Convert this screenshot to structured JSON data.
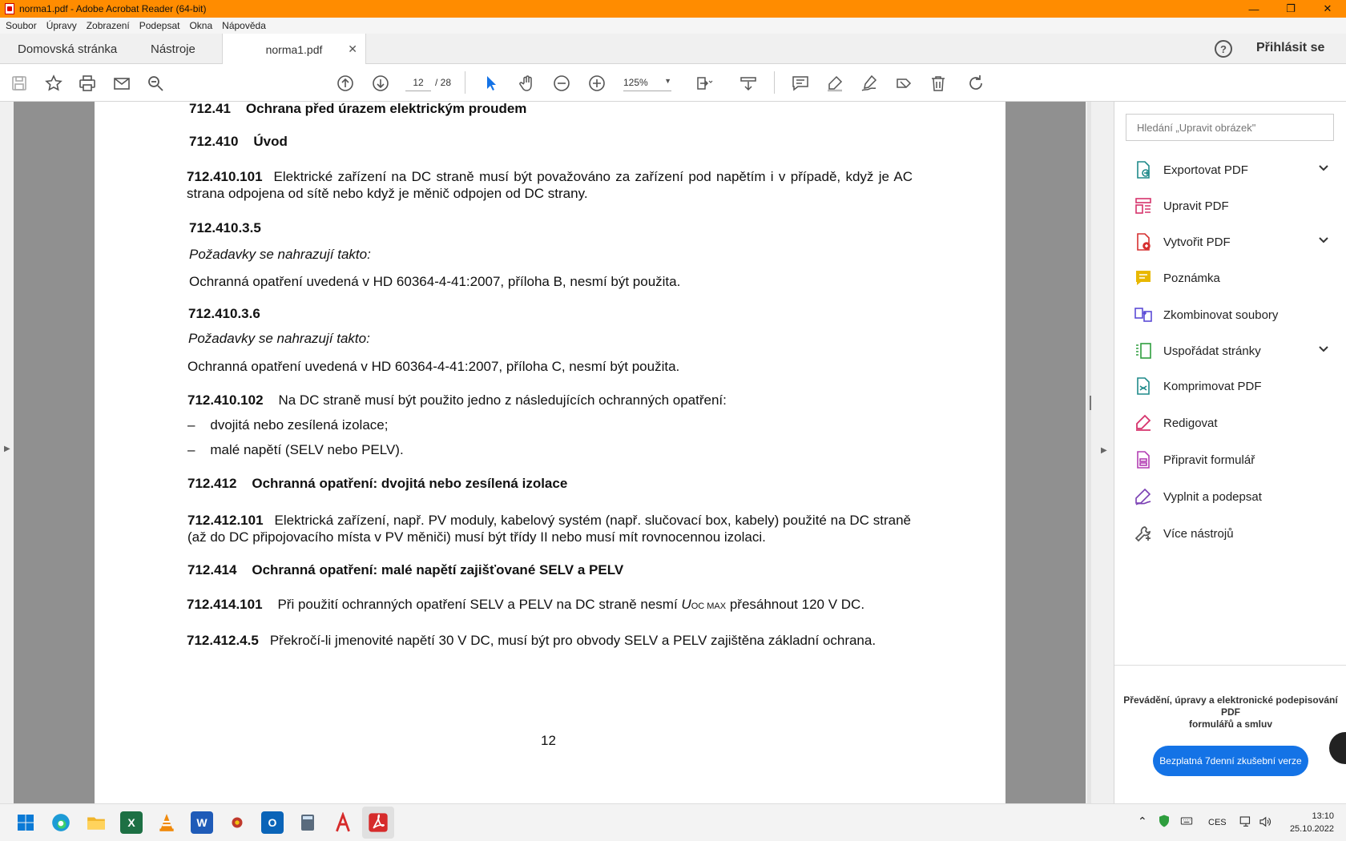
{
  "window": {
    "title": "norma1.pdf - Adobe Acrobat Reader (64-bit)",
    "minimize": "—",
    "maximize": "❐",
    "close": "✕"
  },
  "menu": [
    "Soubor",
    "Úpravy",
    "Zobrazení",
    "Podepsat",
    "Okna",
    "Nápověda"
  ],
  "tabs": {
    "home": "Domovská stránka",
    "tools": "Nástroje",
    "doc": "norma1.pdf",
    "doc_close": "✕",
    "help": "?",
    "signin": "Přihlásit se"
  },
  "toolbar": {
    "page_current": "12",
    "page_total": "/ 28",
    "zoom": "125%"
  },
  "document": {
    "h1": {
      "num": "712.41",
      "text": "Ochrana před úrazem elektrickým proudem"
    },
    "h2": {
      "num": "712.410",
      "text": "Úvod"
    },
    "p1": {
      "num": "712.410.101",
      "text": "Elektrické zařízení na DC straně musí být považováno za zařízení pod napětím i v případě, když je AC strana odpojena od sítě nebo když je měnič odpojen od DC strany."
    },
    "h3": "712.410.3.5",
    "i1": "Požadavky se nahrazují takto:",
    "t1": "Ochranná opatření uvedená v HD 60364-4-41:2007, příloha B, nesmí být použita.",
    "h4": "712.410.3.6",
    "i2": "Požadavky se nahrazují takto:",
    "t2": "Ochranná opatření uvedená v HD 60364-4-41:2007, příloha C, nesmí být použita.",
    "p2": {
      "num": "712.410.102",
      "text": "Na DC straně musí být použito jedno z následujících ochranných opatření:"
    },
    "bullets": [
      "dvojitá nebo zesílená izolace;",
      "malé napětí (SELV nebo PELV)."
    ],
    "bullet_mark": "–",
    "h5": {
      "num": "712.412",
      "text": "Ochranná opatření: dvojitá nebo zesílená izolace"
    },
    "p3": {
      "num": "712.412.101",
      "text": "Elektrická zařízení, např. PV moduly, kabelový systém (např. slučovací box, kabely) použité na DC straně (až do DC připojovacího místa v PV měniči) musí být třídy II nebo musí mít rovnocennou izolaci."
    },
    "h6": {
      "num": "712.414",
      "text": "Ochranná opatření: malé napětí zajišťované SELV a PELV"
    },
    "p4": {
      "num": "712.414.101",
      "pre": "Při použití ochranných opatření SELV a PELV na DC straně nesmí ",
      "u": "U",
      "sub": "OC MAX",
      "post": " přesáhnout 120 V DC."
    },
    "p5": {
      "num": "712.412.4.5",
      "text": "Překročí-li jmenovité napětí 30 V DC, musí být pro obvody SELV a PELV zajištěna základní ochrana."
    },
    "page_number": "12"
  },
  "right_panel": {
    "search_placeholder": "Hledání „Upravit obrázek\"",
    "items": [
      {
        "label": "Exportovat PDF",
        "color": "#1f8a8a"
      },
      {
        "label": "Upravit PDF",
        "color": "#d6336c"
      },
      {
        "label": "Vytvořit PDF",
        "color": "#d63030"
      },
      {
        "label": "Poznámka",
        "color": "#e8b800"
      },
      {
        "label": "Zkombinovat soubory",
        "color": "#5b4bd6"
      },
      {
        "label": "Uspořádat stránky",
        "color": "#2e9e3e"
      },
      {
        "label": "Komprimovat PDF",
        "color": "#1f8a8a"
      },
      {
        "label": "Redigovat",
        "color": "#d6336c"
      },
      {
        "label": "Připravit formulář",
        "color": "#b33fb3"
      },
      {
        "label": "Vyplnit a podepsat",
        "color": "#7a3fb3"
      },
      {
        "label": "Více nástrojů",
        "color": "#555555"
      }
    ],
    "promo_line1": "Převádění, úpravy a elektronické podepisování PDF",
    "promo_line2": "formulářů a smluv",
    "trial_button": "Bezplatná 7denní zkušební verze"
  },
  "taskbar": {
    "lang": "CES",
    "time": "13:10",
    "date": "25.10.2022"
  },
  "colors": {
    "titlebar": "#ff8c00",
    "accent_blue": "#1473e6",
    "doc_bg": "#909090"
  }
}
